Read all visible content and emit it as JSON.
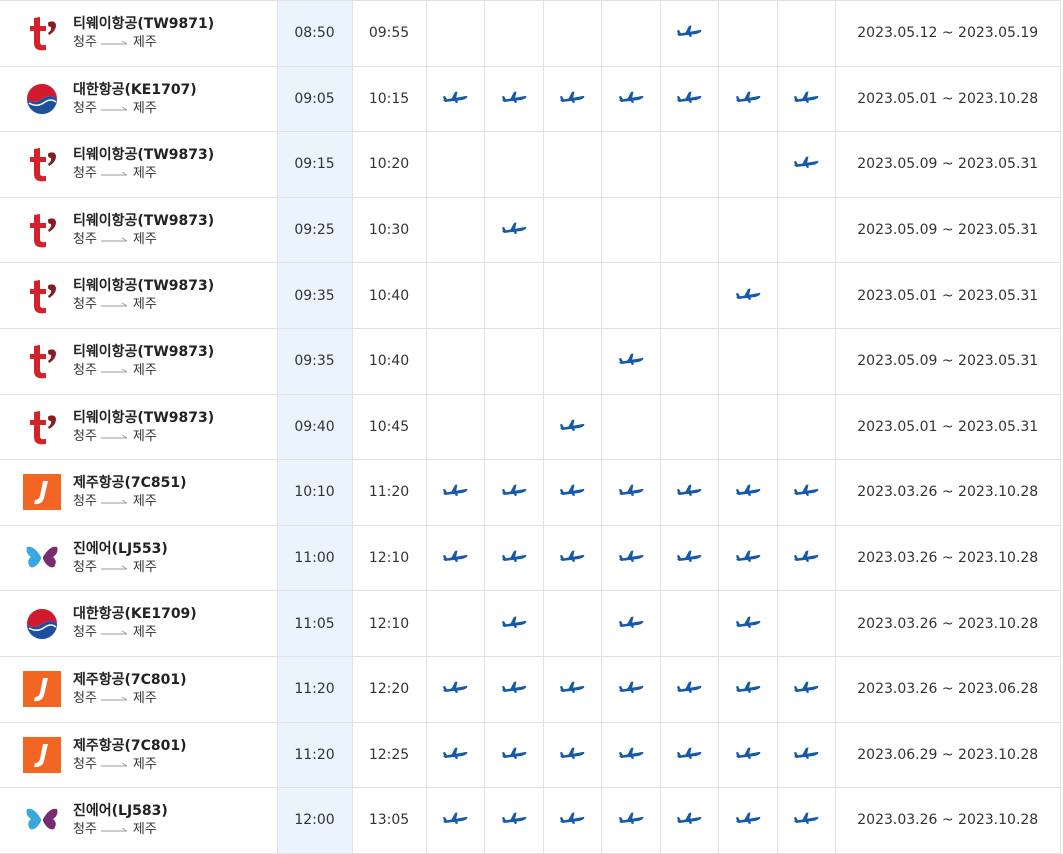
{
  "route_arrow_icon": "long-arrow-right-icon",
  "day_marker_icon": "airplane-icon",
  "colors": {
    "plane_blue": "#1559a8",
    "dep_highlight": "#eaf3fe",
    "tway_red": "#d3222a",
    "korean_red": "#d21a2f",
    "korean_blue": "#1d4f9e",
    "jeju_orange": "#f26522",
    "jin_blue": "#3aa8dc",
    "jin_purple": "#7a2d6e"
  },
  "flights": [
    {
      "logo": "tway",
      "airline": "티웨이항공(TW9871)",
      "from": "청주",
      "to": "제주",
      "dep": "08:50",
      "arr": "09:55",
      "days": [
        false,
        false,
        false,
        false,
        true,
        false,
        false
      ],
      "period": "2023.05.12 ~ 2023.05.19"
    },
    {
      "logo": "korean",
      "airline": "대한항공(KE1707)",
      "from": "청주",
      "to": "제주",
      "dep": "09:05",
      "arr": "10:15",
      "days": [
        true,
        true,
        true,
        true,
        true,
        true,
        true
      ],
      "period": "2023.05.01 ~ 2023.10.28"
    },
    {
      "logo": "tway",
      "airline": "티웨이항공(TW9873)",
      "from": "청주",
      "to": "제주",
      "dep": "09:15",
      "arr": "10:20",
      "days": [
        false,
        false,
        false,
        false,
        false,
        false,
        true
      ],
      "period": "2023.05.09 ~ 2023.05.31"
    },
    {
      "logo": "tway",
      "airline": "티웨이항공(TW9873)",
      "from": "청주",
      "to": "제주",
      "dep": "09:25",
      "arr": "10:30",
      "days": [
        false,
        true,
        false,
        false,
        false,
        false,
        false
      ],
      "period": "2023.05.09 ~ 2023.05.31"
    },
    {
      "logo": "tway",
      "airline": "티웨이항공(TW9873)",
      "from": "청주",
      "to": "제주",
      "dep": "09:35",
      "arr": "10:40",
      "days": [
        false,
        false,
        false,
        false,
        false,
        true,
        false
      ],
      "period": "2023.05.01 ~ 2023.05.31"
    },
    {
      "logo": "tway",
      "airline": "티웨이항공(TW9873)",
      "from": "청주",
      "to": "제주",
      "dep": "09:35",
      "arr": "10:40",
      "days": [
        false,
        false,
        false,
        true,
        false,
        false,
        false
      ],
      "period": "2023.05.09 ~ 2023.05.31"
    },
    {
      "logo": "tway",
      "airline": "티웨이항공(TW9873)",
      "from": "청주",
      "to": "제주",
      "dep": "09:40",
      "arr": "10:45",
      "days": [
        false,
        false,
        true,
        false,
        false,
        false,
        false
      ],
      "period": "2023.05.01 ~ 2023.05.31"
    },
    {
      "logo": "jeju",
      "airline": "제주항공(7C851)",
      "from": "청주",
      "to": "제주",
      "dep": "10:10",
      "arr": "11:20",
      "days": [
        true,
        true,
        true,
        true,
        true,
        true,
        true
      ],
      "period": "2023.03.26 ~ 2023.10.28"
    },
    {
      "logo": "jin",
      "airline": "진에어(LJ553)",
      "from": "청주",
      "to": "제주",
      "dep": "11:00",
      "arr": "12:10",
      "days": [
        true,
        true,
        true,
        true,
        true,
        true,
        true
      ],
      "period": "2023.03.26 ~ 2023.10.28"
    },
    {
      "logo": "korean",
      "airline": "대한항공(KE1709)",
      "from": "청주",
      "to": "제주",
      "dep": "11:05",
      "arr": "12:10",
      "days": [
        false,
        true,
        false,
        true,
        false,
        true,
        false
      ],
      "period": "2023.03.26 ~ 2023.10.28"
    },
    {
      "logo": "jeju",
      "airline": "제주항공(7C801)",
      "from": "청주",
      "to": "제주",
      "dep": "11:20",
      "arr": "12:20",
      "days": [
        true,
        true,
        true,
        true,
        true,
        true,
        true
      ],
      "period": "2023.03.26 ~ 2023.06.28"
    },
    {
      "logo": "jeju",
      "airline": "제주항공(7C801)",
      "from": "청주",
      "to": "제주",
      "dep": "11:20",
      "arr": "12:25",
      "days": [
        true,
        true,
        true,
        true,
        true,
        true,
        true
      ],
      "period": "2023.06.29 ~ 2023.10.28"
    },
    {
      "logo": "jin",
      "airline": "진에어(LJ583)",
      "from": "청주",
      "to": "제주",
      "dep": "12:00",
      "arr": "13:05",
      "days": [
        true,
        true,
        true,
        true,
        true,
        true,
        true
      ],
      "period": "2023.03.26 ~ 2023.10.28"
    }
  ]
}
